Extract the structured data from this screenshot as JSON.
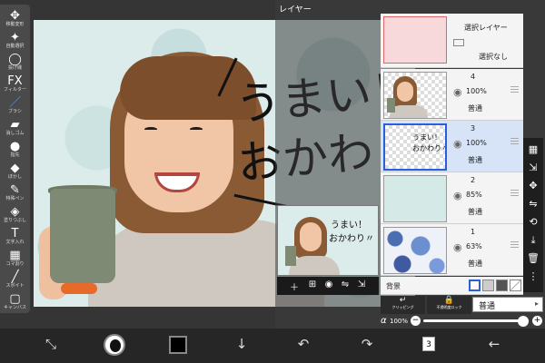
{
  "panel": {
    "title": "レイヤー"
  },
  "left_toolbar": [
    {
      "name": "transform",
      "icon": "✥",
      "label": "移動変形"
    },
    {
      "name": "magic-wand",
      "icon": "✦",
      "label": "自動選択"
    },
    {
      "name": "lasso",
      "icon": "◯",
      "label": "投げ縄"
    },
    {
      "name": "filter",
      "icon": "FX",
      "label": "フィルター"
    },
    {
      "name": "brush",
      "icon": "／",
      "label": "ブラシ"
    },
    {
      "name": "eraser",
      "icon": "▰",
      "label": "消しゴム"
    },
    {
      "name": "smudge",
      "icon": "●",
      "label": "指先"
    },
    {
      "name": "blur",
      "icon": "◆",
      "label": "ぼかし"
    },
    {
      "name": "special-pen",
      "icon": "✎",
      "label": "特殊ペン"
    },
    {
      "name": "fill",
      "icon": "◈",
      "label": "塗りつぶし"
    },
    {
      "name": "text",
      "icon": "T",
      "label": "文字入れ"
    },
    {
      "name": "frame",
      "icon": "▦",
      "label": "コマ割り"
    },
    {
      "name": "eyedropper",
      "icon": "╱",
      "label": "スポイト"
    },
    {
      "name": "canvas",
      "icon": "▢",
      "label": "キャンバス"
    }
  ],
  "canvas_text": {
    "line1": "うまい！",
    "line2": "おかわり"
  },
  "selection_layer": {
    "label": "選択レイヤー",
    "sublabel": "選択なし"
  },
  "layers": [
    {
      "number": "4",
      "opacity": "100%",
      "blend": "普通",
      "selected": false
    },
    {
      "number": "3",
      "opacity": "100%",
      "blend": "普通",
      "selected": true
    },
    {
      "number": "2",
      "opacity": "85%",
      "blend": "普通",
      "selected": false
    },
    {
      "number": "1",
      "opacity": "63%",
      "blend": "普通",
      "selected": false
    }
  ],
  "background": {
    "label": "背景"
  },
  "bottom_buttons": {
    "clipping": "クリッピング",
    "lock": "不透明度ロック"
  },
  "blend_mode": {
    "value": "普通"
  },
  "alpha": {
    "symbol": "α",
    "value": "100%",
    "level": 1.0
  },
  "mini_preview_text": {
    "line1": "うまい！",
    "line2": "おかわり〃"
  },
  "bottom_bar": {
    "layer_count": "3"
  },
  "colors": {
    "accent": "#2b5fd9",
    "active_tool": "#4aa3ff",
    "foreground": "#111111"
  }
}
